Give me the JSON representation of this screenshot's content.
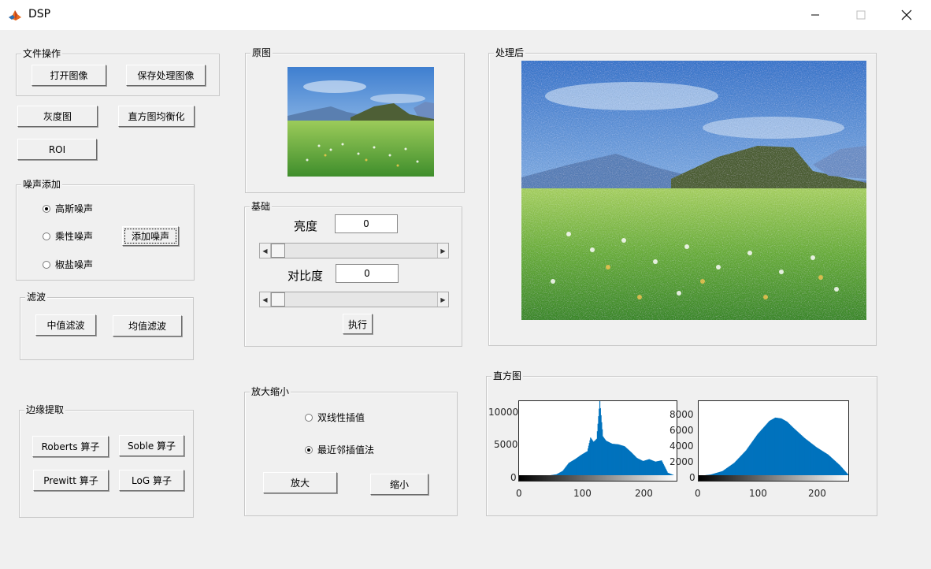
{
  "window": {
    "title": "DSP"
  },
  "file_ops": {
    "title": "文件操作",
    "open_label": "打开图像",
    "save_label": "保存处理图像"
  },
  "basic_ops": {
    "gray_label": "灰度图",
    "hist_eq_label": "直方图均衡化",
    "roi_label": "ROI"
  },
  "noise": {
    "title": "噪声添加",
    "options": [
      "高斯噪声",
      "乘性噪声",
      "椒盐噪声"
    ],
    "selected": "高斯噪声",
    "add_label": "添加噪声"
  },
  "filter": {
    "title": "滤波",
    "median_label": "中值滤波",
    "mean_label": "均值滤波"
  },
  "edge": {
    "title": "边缘提取",
    "roberts_label": "Roberts 算子",
    "soble_label": "Soble 算子",
    "prewitt_label": "Prewitt 算子",
    "log_label": "LoG 算子"
  },
  "original": {
    "title": "原图"
  },
  "basics": {
    "title": "基础",
    "brightness_label": "亮度",
    "brightness_value": "0",
    "brightness_slider": 0.0,
    "contrast_label": "对比度",
    "contrast_value": "0",
    "contrast_slider": 0.0,
    "apply_label": "执行"
  },
  "zoom": {
    "title": "放大缩小",
    "options": [
      "双线性插值",
      "最近邻插值法"
    ],
    "selected": "最近邻插值法",
    "enlarge_label": "放大",
    "shrink_label": "缩小"
  },
  "processed": {
    "title": "处理后"
  },
  "histogram": {
    "title": "直方图",
    "left": {
      "yticks": [
        "10000",
        "5000",
        "0"
      ],
      "xticks": [
        "0",
        "100",
        "200"
      ]
    },
    "right": {
      "yticks": [
        "8000",
        "6000",
        "4000",
        "2000",
        "0"
      ],
      "xticks": [
        "0",
        "100",
        "200"
      ]
    }
  },
  "colors": {
    "hist_bar": "#0072bd",
    "accent": "#0072bd"
  },
  "chart_data": [
    {
      "type": "bar",
      "title": "",
      "xlim": [
        0,
        255
      ],
      "ylim": [
        0,
        12000
      ],
      "x": [
        50,
        60,
        70,
        80,
        90,
        100,
        110,
        115,
        120,
        125,
        130,
        135,
        140,
        150,
        160,
        170,
        180,
        190,
        200,
        210,
        220,
        230,
        240,
        250
      ],
      "values": [
        0,
        150,
        700,
        2000,
        2600,
        3300,
        3900,
        6100,
        5400,
        5900,
        12000,
        6300,
        5600,
        5100,
        5000,
        4700,
        3800,
        2800,
        2300,
        2600,
        2200,
        2400,
        400,
        0
      ]
    },
    {
      "type": "bar",
      "title": "",
      "xlim": [
        0,
        255
      ],
      "ylim": [
        0,
        9000
      ],
      "x": [
        10,
        20,
        40,
        60,
        80,
        100,
        120,
        130,
        140,
        150,
        160,
        180,
        200,
        220,
        240,
        255
      ],
      "values": [
        0,
        80,
        500,
        1500,
        3000,
        5000,
        6600,
        7000,
        6900,
        6500,
        5800,
        4500,
        3400,
        2500,
        1200,
        0
      ]
    }
  ]
}
